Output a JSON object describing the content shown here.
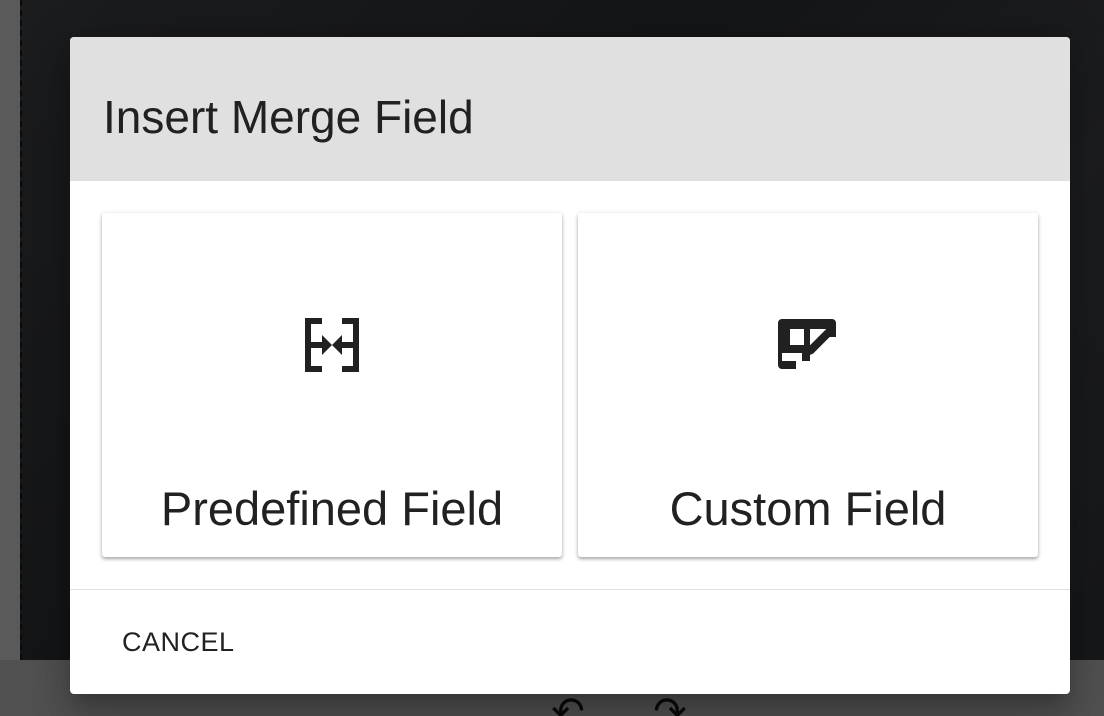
{
  "dialog": {
    "title": "Insert Merge Field",
    "cancel_label": "CANCEL"
  },
  "options": [
    {
      "label": "Predefined Field",
      "icon": "merge-fields-icon"
    },
    {
      "label": "Custom Field",
      "icon": "table-edit-icon"
    }
  ],
  "background": {
    "tools": [
      {
        "icon": "undo-icon",
        "glyph": "↶"
      },
      {
        "icon": "redo-icon",
        "glyph": "↷"
      }
    ]
  },
  "colors": {
    "header_bg": "#e0e0e0",
    "text": "#212121",
    "icon": "#212121"
  }
}
